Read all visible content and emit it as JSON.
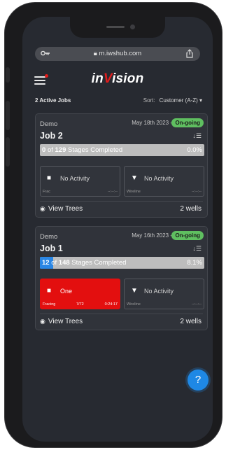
{
  "browser": {
    "url": "m.iwshub.com"
  },
  "header": {
    "logo_prefix": "in",
    "logo_v": "V",
    "logo_suffix": "ision"
  },
  "list": {
    "active_jobs": "2 Active Jobs",
    "sort_label": "Sort:",
    "sort_value": "Customer (A-Z) ▾"
  },
  "jobs": [
    {
      "client": "Demo",
      "date": "May 18th 2023 -",
      "status": "On-going",
      "name": "Job 2",
      "progress": {
        "done": "0",
        "of": "of",
        "total": "129",
        "suffix": "Stages Completed",
        "percent_label": "0.0%",
        "fraction": 0.0
      },
      "tiles": [
        {
          "label": "No Activity",
          "icon": "frac-icon",
          "foot_left": "Frac",
          "foot_mid": "",
          "foot_right": "--:--:--",
          "active": false
        },
        {
          "label": "No Activity",
          "icon": "wireline-icon",
          "foot_left": "Wireline",
          "foot_mid": "",
          "foot_right": "--:--:--",
          "active": false
        }
      ],
      "trees_label": "View Trees",
      "wells": "2 wells"
    },
    {
      "client": "Demo",
      "date": "May 16th 2023 -",
      "status": "On-going",
      "name": "Job 1",
      "progress": {
        "done": "12",
        "of": "of",
        "total": "148",
        "suffix": "Stages Completed",
        "percent_label": "8.1%",
        "fraction": 0.081
      },
      "tiles": [
        {
          "label": "One",
          "icon": "frac-icon",
          "foot_left": "Fracing",
          "foot_mid": "7/72",
          "foot_right": "0:24:17",
          "active": true
        },
        {
          "label": "No Activity",
          "icon": "wireline-icon",
          "foot_left": "Wireline",
          "foot_mid": "",
          "foot_right": "--:--:--",
          "active": false
        }
      ],
      "trees_label": "View Trees",
      "wells": "2 wells"
    }
  ],
  "colors": {
    "background": "#272a31",
    "card": "#30333a",
    "accent_red": "#e30f0f",
    "status_green": "#5fbf60",
    "progress_blue": "#2a86e4",
    "help_blue": "#1e88e5"
  }
}
